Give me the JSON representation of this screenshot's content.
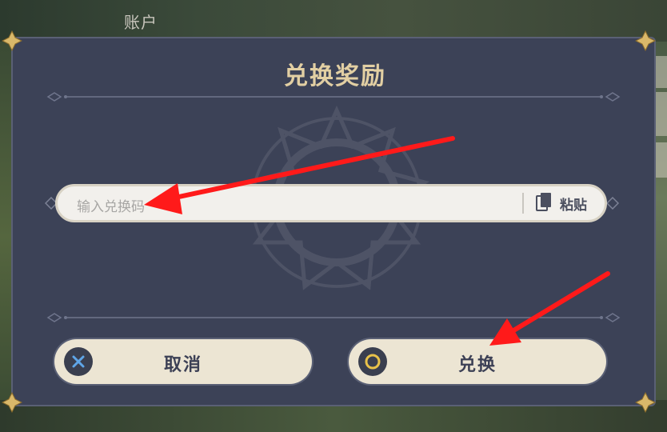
{
  "background": {
    "account_tab": "账户"
  },
  "dialog": {
    "title": "兑换奖励",
    "input": {
      "placeholder": "输入兑换码",
      "value": ""
    },
    "paste_label": "粘贴",
    "cancel_label": "取消",
    "confirm_label": "兑换"
  },
  "colors": {
    "dialog_bg": "#3c4257",
    "title_gold": "#e2cfa3",
    "button_bg": "#ece5d3",
    "arrow_red": "#ff1a1a"
  },
  "icons": {
    "cancel": "x-icon",
    "confirm": "circle-icon",
    "paste": "clipboard-icon"
  }
}
